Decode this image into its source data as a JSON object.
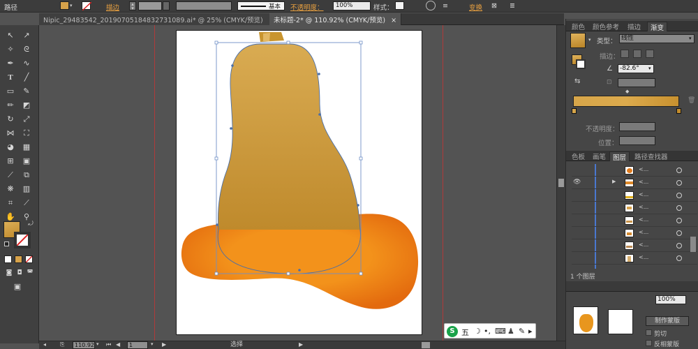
{
  "menu_bar": {
    "path_label": "路径",
    "stroke_label": "描边",
    "basic_label": "基本",
    "opacity_label": "不透明度：",
    "opacity_value": "100%",
    "style_label": "样式：",
    "transform_label": "变换"
  },
  "document_tabs": [
    {
      "label": "Nipic_29483542_20190705184832731089.ai* @ 25% (CMYK/预览)",
      "close": "×"
    },
    {
      "label": "未标题-2* @ 110.92% (CMYK/预览)",
      "close": "×"
    }
  ],
  "status_bar": {
    "zoom": "110.92",
    "page": "1",
    "mode": "选择"
  },
  "gradient_panel": {
    "tabs": [
      "颜色",
      "颜色参考",
      "描边",
      "渐变"
    ],
    "type_label": "类型：",
    "type_value": "线性",
    "stroke_label": "描边：",
    "angle_value": "-82.6°",
    "opacity_label": "不透明度：",
    "position_label": "位置："
  },
  "layers_panel": {
    "tabs": [
      "色板",
      "画笔",
      "图层",
      "路径查找器"
    ],
    "layer_count": "1 个图层"
  },
  "transparency_panel": {
    "opacity_value": "100%",
    "make_mask": "制作蒙版",
    "clip": "剪切",
    "invert_mask": "反相蒙版"
  },
  "ime_bar": {
    "wubi": "五"
  },
  "colors": {
    "gradient_start": "#d9ab52",
    "gradient_end": "#bf8a2c",
    "orange_light": "#f3921b",
    "orange_dark": "#e36a0e",
    "guide": "#b03a3a"
  }
}
